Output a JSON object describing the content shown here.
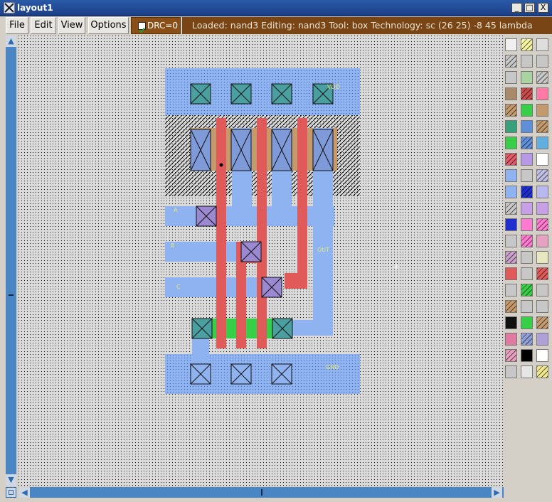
{
  "window": {
    "title": "layout1",
    "minimize_glyph": "_",
    "maximize_glyph": "□",
    "close_glyph": "X"
  },
  "menu": {
    "items": [
      {
        "label": "File"
      },
      {
        "label": "Edit"
      },
      {
        "label": "View"
      },
      {
        "label": "Options"
      }
    ]
  },
  "drc": {
    "label": "DRC=0",
    "checked": true
  },
  "status": {
    "text": "Loaded: nand3 Editing: nand3 Tool: box  Technology: sc    (26 25) -8 45 lambda"
  },
  "colors": {
    "metal": "#8fb3f0",
    "poly": "#e05a5a",
    "diff_p": "#c49a6c",
    "diff_n": "#38cf48",
    "contact": "#4aa0a0",
    "canvas": "#d9d9d9",
    "status_bg": "#7a4514",
    "drc_bg": "#8a4f16",
    "scroll": "#4a86c4",
    "title_bar": "#2a5aa8"
  },
  "layout_labels": {
    "vdd": "VDD",
    "gnd": "GND",
    "in_a": "A",
    "in_b": "B",
    "in_c": "C",
    "out": "OUT"
  },
  "palette": {
    "swatches": [
      [
        "#f0f0f0",
        "#f5f2a0",
        "#dedede"
      ],
      [
        "#c7c7c7",
        "#c7c7c7",
        "#c7c7c7"
      ],
      [
        "#c7c7c7",
        "#a9d3a0",
        "#c7c7c7"
      ],
      [
        "#a88a6a",
        "#c84a4a",
        "#ff7aa6"
      ],
      [
        "#c49a6c",
        "#38cf48",
        "#c49a6c"
      ],
      [
        "#38a07a",
        "#5f8fd8",
        "#c49a6c"
      ],
      [
        "#38cf48",
        "#5f8fd8",
        "#5fb0e0"
      ],
      [
        "#e05a6a",
        "#b69ae8",
        "#ffffff"
      ],
      [
        "#8fb3f0",
        "#c7c7c7",
        "#bfbfe8"
      ],
      [
        "#8fb3f0",
        "#1f2fd0",
        "#b9b9f0"
      ],
      [
        "#c7c7c7",
        "#c8a0e8",
        "#c8a0e8"
      ],
      [
        "#1f2fd0",
        "#ff7ad0",
        "#ff7ad0"
      ],
      [
        "#c7c7c7",
        "#ff7ad0",
        "#e6a0c0"
      ],
      [
        "#c8a0c8",
        "#c7c7c7",
        "#e8e8c0"
      ],
      [
        "#e05a5a",
        "#c7c7c7",
        "#e05a5a"
      ],
      [
        "#c7c7c7",
        "#38cf48",
        "#c7c7c7"
      ],
      [
        "#c49a6c",
        "#c7c7c7",
        "#c7c7c7"
      ],
      [
        "#111111",
        "#38cf48",
        "#c49a6c"
      ],
      [
        "#e07aa0",
        "#8fa0d8",
        "#b0a0d8"
      ],
      [
        "#e6a0c0",
        "#000000",
        "#ffffff"
      ],
      [
        "#c7c7c7",
        "#e6e6e6",
        "#f0e68c"
      ]
    ]
  }
}
